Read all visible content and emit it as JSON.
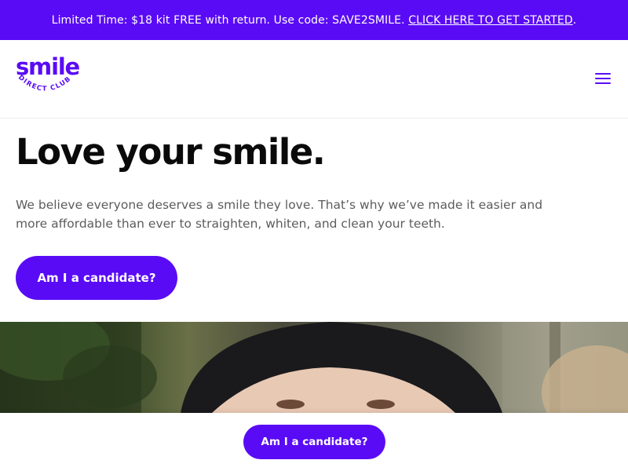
{
  "promo": {
    "text": "Limited Time: $18 kit FREE with return. Use code: SAVE2SMILE.",
    "link_label": "CLICK HERE TO GET STARTED",
    "period": "."
  },
  "header": {
    "logo_word": "smile",
    "logo_tagline": "DIRECT CLUB",
    "menu_icon": "hamburger-menu-icon"
  },
  "hero": {
    "title": "Love your smile.",
    "text": "We believe everyone deserves a smile they love. That’s why we’ve made it easier and more affordable than ever to straighten, whiten, and clean your teeth.",
    "cta_label": "Am I a candidate?"
  },
  "sticky": {
    "cta_label": "Am I a candidate?"
  },
  "colors": {
    "brand": "#5a0bf5",
    "text_dark": "#0a0a0a",
    "text_body": "#5c5c5c"
  }
}
